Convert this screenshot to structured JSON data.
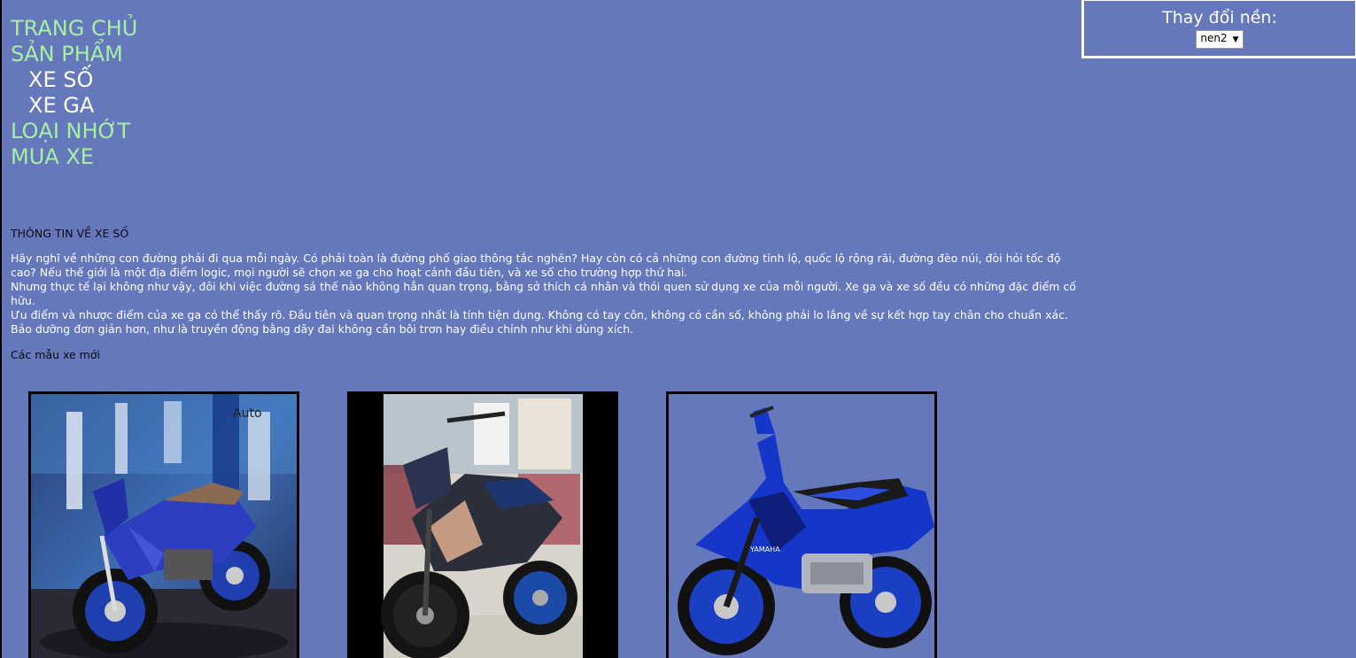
{
  "nav": {
    "home": "TRANG CHỦ",
    "products": "SẢN PHẨM",
    "sub_items": [
      "XE SỐ",
      "XE GA"
    ],
    "oil": "LOẠI NHỚT",
    "buy": "MUA XE"
  },
  "bg_switch": {
    "label": "Thay đổi nền:",
    "selected": "nen2"
  },
  "content": {
    "heading": "THÔNG TIN VỀ XE SỐ",
    "paragraphs": [
      "Hãy nghĩ về những con đường phải đi qua mỗi ngày. Có phải toàn là đường phố giao thông tắc nghẽn? Hay còn có cả những con đường tỉnh lộ, quốc lộ rộng rãi, đường đèo núi, đòi hỏi tốc độ cao? Nếu thế giới là một địa điểm logic, mọi người sẽ chọn xe ga cho hoạt cảnh đầu tiên, và xe số cho trường hợp thứ hai.",
      "Nhưng thực tế lại không như vậy, đôi khi việc đường sá thế nào không hẳn quan trọng, bằng sở thích cá nhân và thói quen sử dụng xe của mỗi người. Xe ga và xe số đều có những đặc điểm cố hữu.",
      "Ưu điểm và nhược điểm của xe ga có thể thấy rõ. Đầu tiên và quan trọng nhất là tính tiện dụng. Không có tay côn, không có cần số, không phải lo lắng về sự kết hợp tay chân cho chuẩn xác. Bảo dưỡng đơn giản hơn, như là truyền động bằng dây đai không cần bôi trơn hay điều chỉnh như khi dùng xích."
    ],
    "new_models": "Các mẫu xe mới"
  },
  "gallery": {
    "images": [
      {
        "name": "motorbike-photo-1",
        "watermark": "Auto"
      },
      {
        "name": "motorbike-photo-2"
      },
      {
        "name": "motorbike-photo-3",
        "brand": "YAMAHA"
      }
    ]
  }
}
